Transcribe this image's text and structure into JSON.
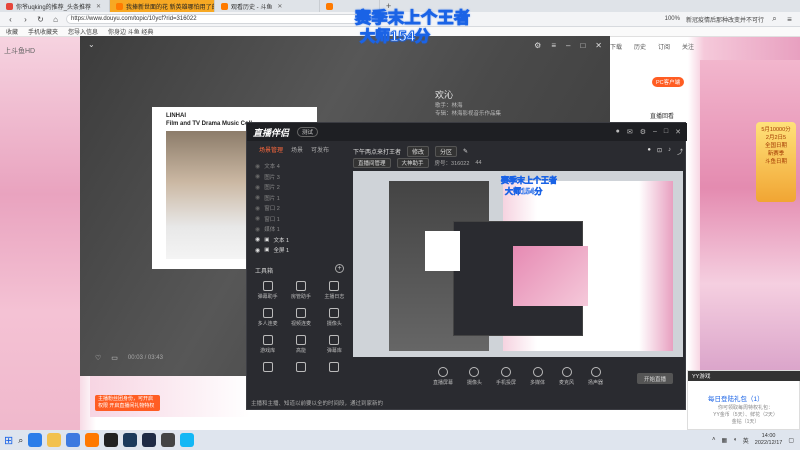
{
  "browser": {
    "tabs": [
      {
        "label": "你爷uqking的推荐_头条推荐",
        "active": false
      },
      {
        "label": "我捧新世面的花 新英雄哪怕用了的",
        "active": true
      },
      {
        "label": "观看历史 - 斗鱼",
        "active": false
      },
      {
        "label": "",
        "active": false
      }
    ],
    "url": "https://www.douyu.com/topic/10ycf?rid=316022",
    "zoom": "100%",
    "search_hint": "新冠疫情后那种改变并不可行",
    "bookmarks": [
      "收藏",
      "手机收藏夹",
      "您导入信息",
      "你身边 斗鱼 经典"
    ]
  },
  "overlay": {
    "line1": "赛季末上个王者",
    "line2": "大师154分"
  },
  "page": {
    "site_label": "上斗鱼HD",
    "user_items": [
      "下载",
      "历史",
      "订阅",
      "关注"
    ],
    "pc_client": "PC客户端",
    "hot_rank": "直播回看",
    "promo_lines": [
      "5月10000分",
      "2月2日5",
      "全国日期",
      "新赛季",
      "斗鱼日期"
    ],
    "red_banner": "主播粉丝团身份，可开启权限 开启直播间礼物特权"
  },
  "player": {
    "welcome": "欢沁",
    "meta_lines": [
      "歌手：林海",
      "专辑：林海影视音乐作品集"
    ],
    "album_line1": "LINHAI",
    "album_line2": "Film and TV Drama Music Coll",
    "timecode": "00:03 / 03:43"
  },
  "assistant": {
    "title": "直播伴侣",
    "version": "测试",
    "scene_tabs": [
      "场景管理",
      "场景",
      "可发布"
    ],
    "sources": [
      {
        "label": "文本 4",
        "visible": false
      },
      {
        "label": "图片 3",
        "visible": false
      },
      {
        "label": "图片 2",
        "visible": false
      },
      {
        "label": "图片 1",
        "visible": false
      },
      {
        "label": "窗口 2",
        "visible": false
      },
      {
        "label": "窗口 1",
        "visible": false
      },
      {
        "label": "媒体 1",
        "visible": false
      },
      {
        "label": "文本 1",
        "visible": true
      },
      {
        "label": "全屏 1",
        "visible": true
      }
    ],
    "tools_label": "工具箱",
    "tools": [
      "弹幕助手",
      "房管助手",
      "主播日志",
      "多人连麦",
      "视频连麦",
      "摄像头",
      "游戏库",
      "高能",
      "弹幕库",
      "",
      "",
      ""
    ],
    "room_title": "下午两点来打王者",
    "room_edit": "修改",
    "room_category": "分区",
    "room_line2": [
      "直播间管理",
      "大神助手",
      "房号：316022",
      "44"
    ],
    "controls": [
      "直播屏幕",
      "摄像头",
      "手机投屏",
      "多媒体",
      "麦克风",
      "扬声器"
    ],
    "start_live": "开始直播",
    "footer": "主播和主播、知道以前要以全的时间段，通过到家新的"
  },
  "chat": {
    "header": "YY游戏",
    "title": "每日登陆礼包（1）",
    "body_lines": [
      "你可领取每周特权礼包：",
      "YY金币（5天）、鲜花（2天）",
      "金钻（1天）"
    ]
  },
  "taskbar": {
    "tray_time": "14:00",
    "tray_date": "2022/12/17",
    "tray_lang": "英"
  },
  "colors": {
    "active_tab": "#f7a823",
    "overlay_stroke": "#1a63e6",
    "accent_orange": "#ff5d23"
  }
}
